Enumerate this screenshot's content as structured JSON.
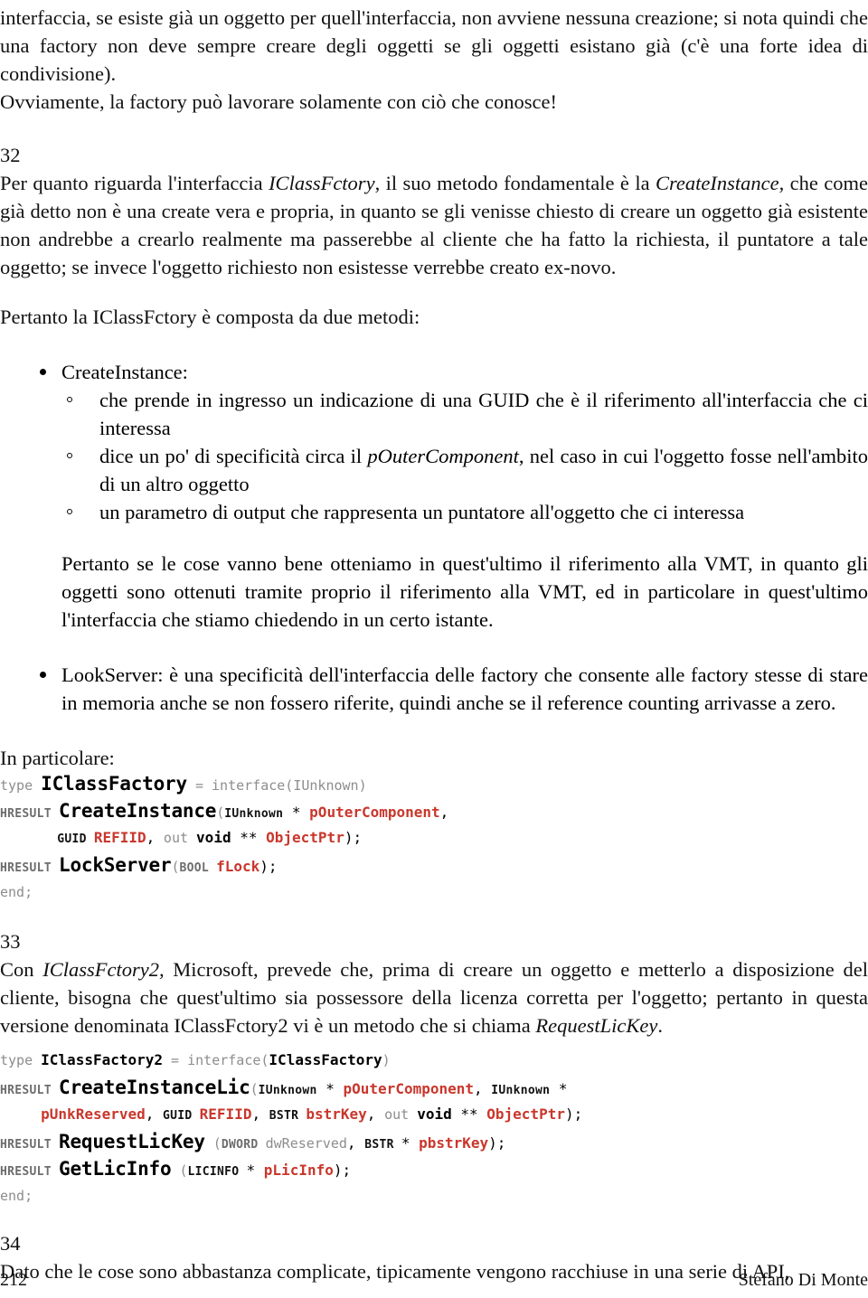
{
  "document": {
    "intro_paragraph": "interfaccia, se esiste già un oggetto per quell'interfaccia, non avviene nessuna creazione; si nota quindi che una factory non deve sempre creare degli oggetti se gli oggetti esistano già (c'è una forte idea di condivisione).",
    "intro_paragraph_2": "Ovviamente, la factory può lavorare solamente con ciò che conosce!"
  },
  "section_32": {
    "number": "32",
    "para_a": "Per quanto riguarda l'interfaccia ",
    "para_a_italic_1": "IClassFctory",
    "para_a_mid": ", il suo metodo fondamentale è la ",
    "para_a_italic_2": "CreateInstance,",
    "para_a_end": " che come già detto non è una create vera e propria, in quanto se gli venisse chiesto di creare un oggetto già esistente non andrebbe a crearlo realmente ma passerebbe al cliente che ha fatto la richiesta, il puntatore a tale oggetto; se invece l'oggetto richiesto non esistesse verrebbe creato ex-novo.",
    "para_b": "Pertanto la  IClassFctory è composta da due metodi:",
    "bullets": [
      {
        "label": "CreateInstance:",
        "subitems": [
          {
            "text_before": "che prende in ingresso un indicazione di una GUID che è il riferimento all'interfaccia che ci interessa",
            "italic": "",
            "text_after": ""
          },
          {
            "text_before": "dice un po' di specificità circa il ",
            "italic": "pOuterComponent",
            "text_after": ", nel caso in cui l'oggetto fosse nell'ambito di un altro oggetto"
          },
          {
            "text_before": "un parametro di output che rappresenta un puntatore all'oggetto che ci interessa",
            "italic": "",
            "text_after": ""
          }
        ],
        "followup": "Pertanto se le cose vanno bene otteniamo in quest'ultimo il riferimento alla VMT, in quanto gli oggetti sono ottenuti tramite proprio il riferimento alla VMT, ed in particolare in quest'ultimo l'interfaccia che stiamo chiedendo in un certo istante."
      },
      {
        "label": "LookServer: è una specificità dell'interfaccia delle factory che consente alle factory stesse di stare in memoria anche se non fossero riferite, quindi anche se il reference counting arrivasse a zero.",
        "subitems": [],
        "followup": ""
      }
    ],
    "in_particolare": "In particolare:"
  },
  "code_block_1": {
    "lines": [
      [
        {
          "t": "type ",
          "c": "kw"
        },
        {
          "t": "IClassFactory",
          "c": "name"
        },
        {
          "t": " = ",
          "c": "gry"
        },
        {
          "t": "interface(IUnknown)",
          "c": "gry"
        }
      ],
      [
        {
          "t": "HRESULT ",
          "c": "sml"
        },
        {
          "t": "CreateInstance",
          "c": "name"
        },
        {
          "t": "(",
          "c": "gry"
        },
        {
          "t": "IUnknown",
          "c": "smlblk"
        },
        {
          "t": " * ",
          "c": "punct"
        },
        {
          "t": "pOuterComponent",
          "c": "red"
        },
        {
          "t": ",",
          "c": "punct"
        }
      ],
      [
        {
          "t": "       ",
          "c": "gry"
        },
        {
          "t": "GUID ",
          "c": "smlblk"
        },
        {
          "t": "REFIID",
          "c": "red"
        },
        {
          "t": ", ",
          "c": "punct"
        },
        {
          "t": "out ",
          "c": "gry"
        },
        {
          "t": "void ",
          "c": "blk"
        },
        {
          "t": "** ",
          "c": "punct"
        },
        {
          "t": "ObjectPtr",
          "c": "red"
        },
        {
          "t": ");",
          "c": "punct"
        }
      ],
      [
        {
          "t": "HRESULT ",
          "c": "sml"
        },
        {
          "t": "LockServer",
          "c": "name"
        },
        {
          "t": "(",
          "c": "gry"
        },
        {
          "t": "BOOL ",
          "c": "sml"
        },
        {
          "t": "fLock",
          "c": "red"
        },
        {
          "t": ");",
          "c": "punct"
        }
      ],
      [
        {
          "t": "end;",
          "c": "kw"
        }
      ]
    ]
  },
  "section_33": {
    "number": "33",
    "para_start": "Con  ",
    "para_italic_1": "IClassFctory2,",
    "para_mid": " Microsoft, prevede che, prima di creare un oggetto e metterlo a disposizione del cliente, bisogna che quest'ultimo sia possessore della licenza corretta per l'oggetto; pertanto in questa versione denominata IClassFctory2 vi è un metodo che si chiama ",
    "para_italic_2": "RequestLicKey",
    "para_end": "."
  },
  "code_block_2": {
    "lines": [
      [
        {
          "t": "type ",
          "c": "kw"
        },
        {
          "t": "IClassFactory2",
          "c": "blk"
        },
        {
          "t": " = ",
          "c": "gry"
        },
        {
          "t": "interface(",
          "c": "gry"
        },
        {
          "t": "IClassFactory",
          "c": "blk"
        },
        {
          "t": ")",
          "c": "gry"
        }
      ],
      [
        {
          "t": "HRESULT ",
          "c": "sml"
        },
        {
          "t": "CreateInstanceLic",
          "c": "name"
        },
        {
          "t": "(",
          "c": "gry"
        },
        {
          "t": "IUnknown",
          "c": "smlblk"
        },
        {
          "t": " * ",
          "c": "punct"
        },
        {
          "t": "pOuterComponent",
          "c": "red"
        },
        {
          "t": ", ",
          "c": "punct"
        },
        {
          "t": "IUnknown",
          "c": "smlblk"
        },
        {
          "t": " *",
          "c": "punct"
        }
      ],
      [
        {
          "t": "     ",
          "c": "gry"
        },
        {
          "t": "pUnkReserved",
          "c": "red"
        },
        {
          "t": ", ",
          "c": "punct"
        },
        {
          "t": "GUID ",
          "c": "smlblk"
        },
        {
          "t": "REFIID",
          "c": "red"
        },
        {
          "t": ", ",
          "c": "punct"
        },
        {
          "t": "BSTR ",
          "c": "smlblk"
        },
        {
          "t": "bstrKey",
          "c": "red"
        },
        {
          "t": ", ",
          "c": "punct"
        },
        {
          "t": "out ",
          "c": "gry"
        },
        {
          "t": "void ",
          "c": "blk"
        },
        {
          "t": "** ",
          "c": "punct"
        },
        {
          "t": "ObjectPtr",
          "c": "red"
        },
        {
          "t": ");",
          "c": "punct"
        }
      ],
      [
        {
          "t": "HRESULT ",
          "c": "sml"
        },
        {
          "t": "RequestLicKey",
          "c": "name"
        },
        {
          "t": " (",
          "c": "gry"
        },
        {
          "t": "DWORD ",
          "c": "sml"
        },
        {
          "t": "dwReserved",
          "c": "gry"
        },
        {
          "t": ", ",
          "c": "punct"
        },
        {
          "t": "BSTR ",
          "c": "smlblk"
        },
        {
          "t": "* ",
          "c": "punct"
        },
        {
          "t": "pbstrKey",
          "c": "red"
        },
        {
          "t": ");",
          "c": "punct"
        }
      ],
      [
        {
          "t": "HRESULT ",
          "c": "sml"
        },
        {
          "t": "GetLicInfo",
          "c": "name"
        },
        {
          "t": " (",
          "c": "gry"
        },
        {
          "t": "LICINFO ",
          "c": "smlblk"
        },
        {
          "t": "* ",
          "c": "punct"
        },
        {
          "t": "pLicInfo",
          "c": "red"
        },
        {
          "t": ");",
          "c": "punct"
        }
      ],
      [
        {
          "t": "end;",
          "c": "kw"
        }
      ]
    ]
  },
  "section_34": {
    "number": "34",
    "para": "Dato che le cose sono abbastanza complicate, tipicamente vengono racchiuse in una serie di API,"
  },
  "footer": {
    "page_number": "212",
    "author": "Stefano Di Monte"
  },
  "colors": {
    "code_red": "#c9372c",
    "code_gray": "#8d8d8d",
    "text": "#111111"
  }
}
